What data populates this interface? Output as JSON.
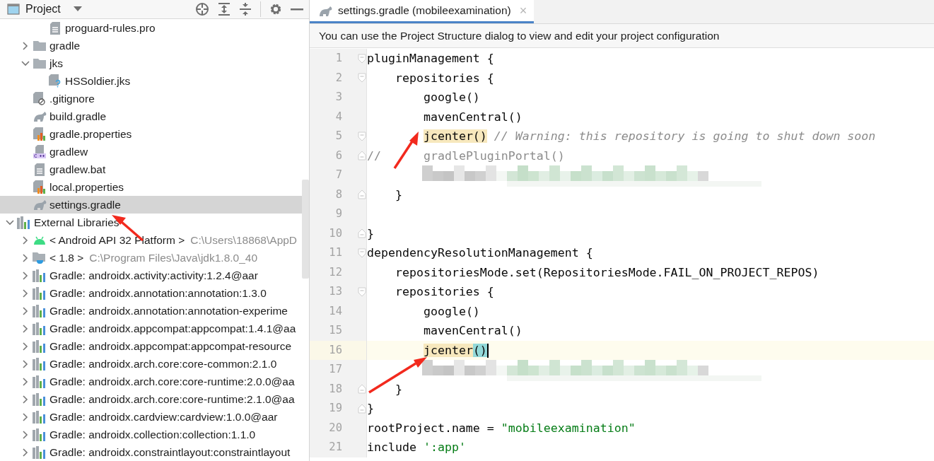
{
  "project_panel": {
    "title": "Project"
  },
  "tree": {
    "partial_branch": [
      {
        "label": "proguard-rules.pro",
        "kind": "text",
        "selected": false
      }
    ],
    "items": [
      {
        "label": "gradle",
        "kind": "folder",
        "expanded": false,
        "selected": false
      },
      {
        "label": "jks",
        "kind": "folder",
        "expanded": true,
        "selected": false,
        "children": [
          {
            "label": "HSSoldier.jks",
            "kind": "unknown",
            "selected": false
          }
        ]
      },
      {
        "label": ".gitignore",
        "kind": "ignore",
        "selected": false
      },
      {
        "label": "build.gradle",
        "kind": "gradle",
        "selected": false
      },
      {
        "label": "gradle.properties",
        "kind": "props",
        "selected": false
      },
      {
        "label": "gradlew",
        "kind": "cpp",
        "selected": false
      },
      {
        "label": "gradlew.bat",
        "kind": "text",
        "selected": false
      },
      {
        "label": "local.properties",
        "kind": "props",
        "selected": false
      },
      {
        "label": "settings.gradle",
        "kind": "gradle",
        "selected": true
      }
    ],
    "roots": [
      {
        "label": "External Libraries",
        "kind": "lib",
        "expanded": true,
        "selected": false,
        "children": [
          {
            "label": "< Android API 32 Platform >",
            "path": "C:\\Users\\18868\\AppD",
            "kind": "android",
            "expanded": false,
            "selected": false
          },
          {
            "label": "< 1.8 >",
            "path": "C:\\Program Files\\Java\\jdk1.8.0_40",
            "kind": "jdk",
            "expanded": false,
            "selected": false
          },
          {
            "label": "Gradle: androidx.activity:activity:1.2.4@aar",
            "kind": "lib",
            "expanded": false,
            "selected": false
          },
          {
            "label": "Gradle: androidx.annotation:annotation:1.3.0",
            "kind": "lib",
            "expanded": false,
            "selected": false
          },
          {
            "label": "Gradle: androidx.annotation:annotation-experime",
            "kind": "lib",
            "expanded": false,
            "selected": false
          },
          {
            "label": "Gradle: androidx.appcompat:appcompat:1.4.1@aa",
            "kind": "lib",
            "expanded": false,
            "selected": false
          },
          {
            "label": "Gradle: androidx.appcompat:appcompat-resource",
            "kind": "lib",
            "expanded": false,
            "selected": false
          },
          {
            "label": "Gradle: androidx.arch.core:core-common:2.1.0",
            "kind": "lib",
            "expanded": false,
            "selected": false
          },
          {
            "label": "Gradle: androidx.arch.core:core-runtime:2.0.0@aa",
            "kind": "lib",
            "expanded": false,
            "selected": false
          },
          {
            "label": "Gradle: androidx.arch.core:core-runtime:2.1.0@aa",
            "kind": "lib",
            "expanded": false,
            "selected": false
          },
          {
            "label": "Gradle: androidx.cardview:cardview:1.0.0@aar",
            "kind": "lib",
            "expanded": false,
            "selected": false
          },
          {
            "label": "Gradle: androidx.collection:collection:1.1.0",
            "kind": "lib",
            "expanded": false,
            "selected": false
          },
          {
            "label": "Gradle: androidx.constraintlayout:constraintlayout",
            "kind": "lib",
            "expanded": false,
            "selected": false
          }
        ]
      }
    ]
  },
  "editor": {
    "tab": {
      "title": "settings.gradle (mobileexamination)",
      "close": "×",
      "selected": true
    },
    "banner": "You can use the Project Structure dialog to view and edit your project configuration",
    "lines": [
      {
        "number": "1",
        "fold_start": true,
        "segments": [
          {
            "text": "pluginManagement {",
            "kind": "plain"
          }
        ]
      },
      {
        "number": "2",
        "fold_start": true,
        "segments": [
          {
            "text": "    repositories {",
            "kind": "plain"
          }
        ]
      },
      {
        "number": "3",
        "segments": [
          {
            "text": "        google()",
            "kind": "plain"
          }
        ]
      },
      {
        "number": "4",
        "segments": [
          {
            "text": "        mavenCentral()",
            "kind": "plain"
          }
        ]
      },
      {
        "number": "5",
        "fold_start": true,
        "segments": [
          {
            "text": "        jcenter()",
            "kind": "highlight"
          },
          {
            "text": " // Warning: this repository is going to shut down soon",
            "kind": "comment"
          }
        ]
      },
      {
        "number": "6",
        "fold_end": true,
        "segments": [
          {
            "text": "//",
            "kind": "muted"
          },
          {
            "text": "      gradlePluginPortal()",
            "kind": "muted"
          }
        ]
      },
      {
        "number": "7",
        "kind": "blurred"
      },
      {
        "number": "8",
        "fold_end": true,
        "segments": [
          {
            "text": "    }",
            "kind": "plain"
          }
        ]
      },
      {
        "number": "9"
      },
      {
        "number": "10",
        "fold_end": true,
        "segments": [
          {
            "text": "}",
            "kind": "plain"
          }
        ]
      },
      {
        "number": "11",
        "fold_start": true,
        "segments": [
          {
            "text": "dependencyResolutionManagement {",
            "kind": "plain"
          }
        ]
      },
      {
        "number": "12",
        "segments": [
          {
            "text": "    repositoriesMode.set(RepositoriesMode.FAIL_ON_PROJECT_REPOS)",
            "kind": "plain"
          }
        ]
      },
      {
        "number": "13",
        "fold_start": true,
        "segments": [
          {
            "text": "    repositories {",
            "kind": "plain"
          }
        ]
      },
      {
        "number": "14",
        "segments": [
          {
            "text": "        google()",
            "kind": "plain"
          }
        ]
      },
      {
        "number": "15",
        "segments": [
          {
            "text": "        mavenCentral()",
            "kind": "plain"
          }
        ]
      },
      {
        "number": "16",
        "current": true,
        "caret": true,
        "segments": [
          {
            "text": "        jcenter",
            "kind": "highlight"
          },
          {
            "text": "()",
            "kind": "match"
          }
        ]
      },
      {
        "number": "17",
        "kind": "blurred"
      },
      {
        "number": "18",
        "fold_end": true,
        "segments": [
          {
            "text": "    }",
            "kind": "plain"
          }
        ]
      },
      {
        "number": "19",
        "fold_end": true,
        "segments": [
          {
            "text": "}",
            "kind": "plain"
          }
        ]
      },
      {
        "number": "20",
        "segments": [
          {
            "text": "rootProject.name = ",
            "kind": "plain"
          },
          {
            "text": "\"mobileexamination\"",
            "kind": "string"
          }
        ]
      },
      {
        "number": "21",
        "segments": [
          {
            "text": "include ",
            "kind": "plain"
          },
          {
            "text": "':app'",
            "kind": "string"
          }
        ]
      }
    ]
  }
}
